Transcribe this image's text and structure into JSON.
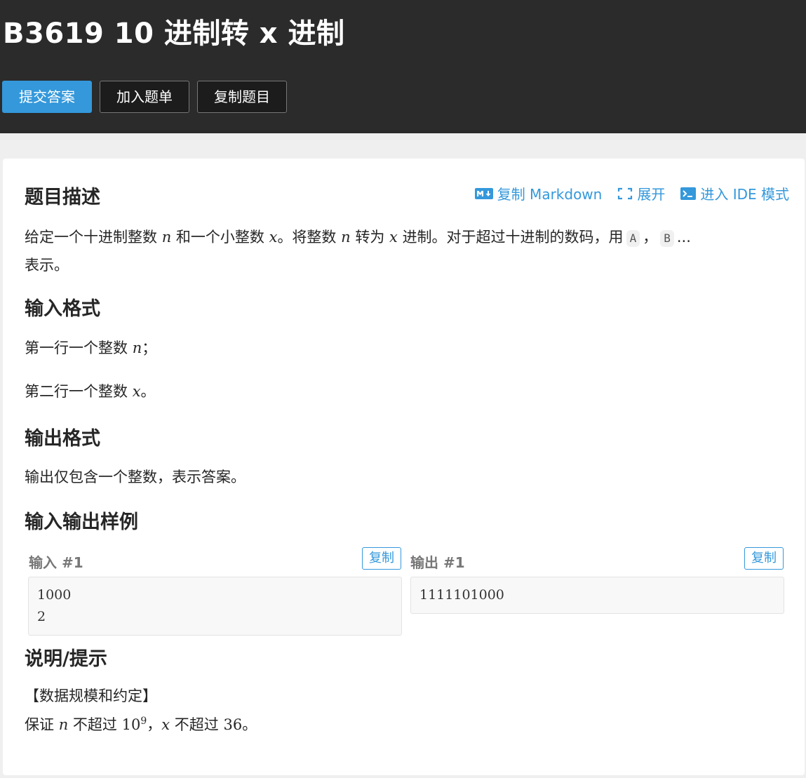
{
  "header": {
    "title": "B3619 10 进制转 x 进制",
    "buttons": {
      "submit": "提交答案",
      "add_list": "加入题单",
      "copy_problem": "复制题目"
    }
  },
  "tools": {
    "copy_markdown": "复制 Markdown",
    "expand": "展开",
    "ide": "进入 IDE 模式"
  },
  "sections": {
    "description_title": "题目描述",
    "description": {
      "p1": "给定一个十进制整数",
      "var_n": "n",
      "p2": "和一个小整数",
      "var_x": "x",
      "p3": "。将整数",
      "p4": "转为",
      "p5": "进制。对于超过十进制的数码，用",
      "code_a": "A",
      "sep": "，",
      "code_b": "B",
      "p6": "...",
      "p7": "表示。"
    },
    "input_title": "输入格式",
    "input_line1_pre": "第一行一个整数",
    "input_line1_post": "；",
    "input_line2_pre": "第二行一个整数",
    "input_line2_post": "。",
    "output_title": "输出格式",
    "output_text": "输出仅包含一个整数，表示答案。",
    "samples_title": "输入输出样例",
    "hint_title": "说明/提示",
    "hint_line1": "【数据规模和约定】",
    "hint_line2_a": "保证",
    "hint_line2_b": "不超过",
    "hint_base": "10",
    "hint_exp": "9",
    "hint_line2_c": "，",
    "hint_line2_d": "不超过",
    "hint_max": "36",
    "hint_line2_e": "。"
  },
  "samples": {
    "input_label": "输入 #1",
    "output_label": "输出 #1",
    "copy_label": "复制",
    "input_value": "1000\n2",
    "output_value": "1111101000"
  },
  "colors": {
    "accent": "#3498db",
    "header_bg": "#2b2b2b"
  }
}
